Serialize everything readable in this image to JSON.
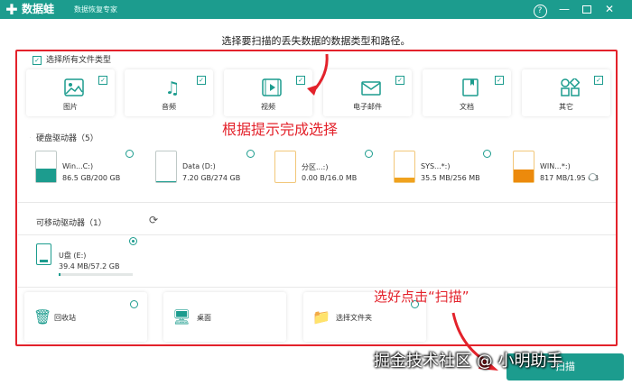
{
  "titlebar": {
    "app_name": "数据蛙",
    "app_subtitle": "数据恢复专家",
    "help_glyph": "?",
    "min_glyph": "—",
    "close_glyph": "✕"
  },
  "instruction": "选择要扫描的丢失数据的数据类型和路径。",
  "select_all": {
    "label": "选择所有文件类型",
    "checked": true
  },
  "file_types": [
    {
      "label": "图片",
      "icon": "image-icon",
      "checked": true
    },
    {
      "label": "音频",
      "icon": "music-icon",
      "checked": true
    },
    {
      "label": "视频",
      "icon": "video-icon",
      "checked": true
    },
    {
      "label": "电子邮件",
      "icon": "mail-icon",
      "checked": true
    },
    {
      "label": "文档",
      "icon": "document-icon",
      "checked": true
    },
    {
      "label": "其它",
      "icon": "other-icon",
      "checked": true
    }
  ],
  "callout_select": "根据提示完成选择",
  "hard_drives": {
    "title": "硬盘驱动器（5）",
    "items": [
      {
        "name": "Win...C:)",
        "size": "86.5 GB/200 GB",
        "used": 0.43,
        "color": "#1c9c8e"
      },
      {
        "name": "Data (D:)",
        "size": "7.20 GB/274 GB",
        "used": 0.03,
        "color": "#1c9c8e"
      },
      {
        "name": "分区...:)",
        "size": "0.00  B/16.0 MB",
        "used": 0.0,
        "color": "#1c9c8e"
      },
      {
        "name": "SYS...*:)",
        "size": "35.5 MB/256 MB",
        "used": 0.14,
        "color": "#f0a21e"
      },
      {
        "name": "WIN...*:)",
        "size": "817 MB/1.95 GB",
        "used": 0.42,
        "color": "#ec8a0c"
      }
    ]
  },
  "removable": {
    "title": "可移动驱动器（1）",
    "usb_name": "U盘 (E:)",
    "usb_size": "39.4 MB/57.2 GB",
    "usb_used": 0.02,
    "selected": true
  },
  "locations": [
    {
      "label": "回收站",
      "icon": "recycle-bin-icon",
      "glyph": "🗑"
    },
    {
      "label": "桌面",
      "icon": "desktop-icon",
      "glyph": "🖥"
    },
    {
      "label": "选择文件夹",
      "icon": "folder-icon",
      "glyph": "📁"
    }
  ],
  "callout_scan": "选好点击“扫描”",
  "scan_button": "扫描",
  "watermark": "掘金技术社区 @ 小明助手",
  "colors": {
    "accent": "#1c9c8e",
    "annotation": "#e3222b"
  }
}
